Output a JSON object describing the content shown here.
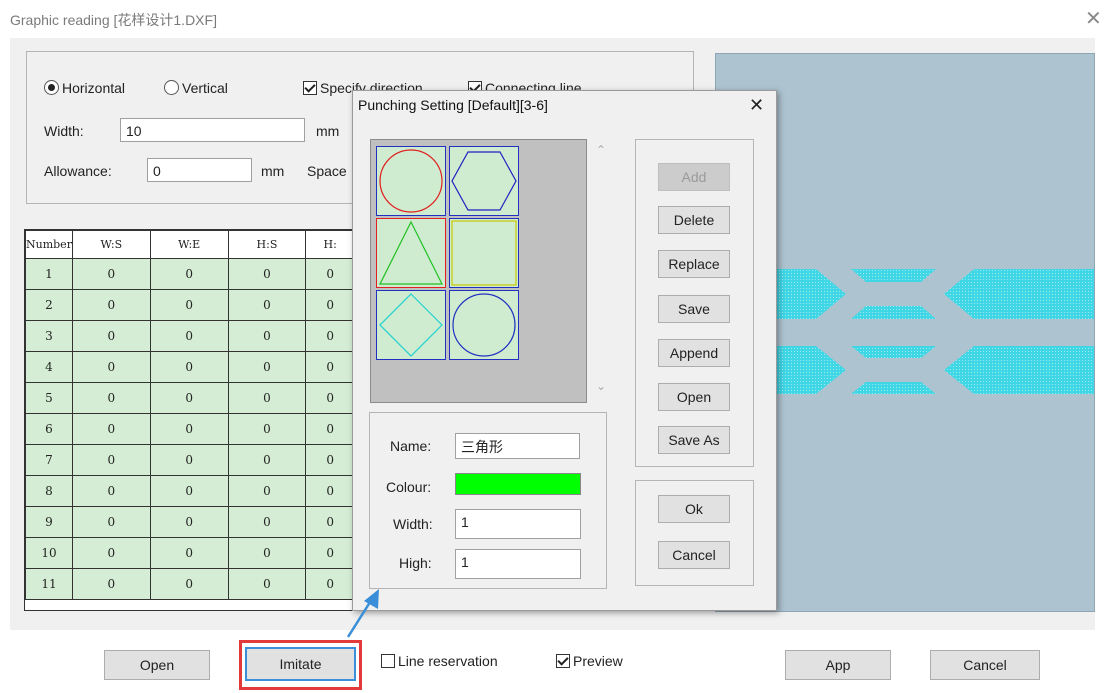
{
  "window": {
    "title": "Graphic reading [花样设计1.DXF]",
    "close_symbol": "✕"
  },
  "settings": {
    "horizontal_label": "Horizontal",
    "vertical_label": "Vertical",
    "orientation_selected": "Horizontal",
    "specify_direction_label": "Specify direction",
    "specify_direction_checked": true,
    "connecting_line_label": "Connecting line",
    "connecting_line_checked": true,
    "width_label": "Width:",
    "width_value": "10",
    "width_unit": "mm",
    "allowance_label": "Allowance:",
    "allowance_value": "0",
    "allowance_unit": "mm",
    "space_label": "Space"
  },
  "table": {
    "headers": [
      "Number",
      "W:S",
      "W:E",
      "H:S",
      "H:"
    ],
    "rows": [
      [
        "1",
        "0",
        "0",
        "0",
        "0"
      ],
      [
        "2",
        "0",
        "0",
        "0",
        "0"
      ],
      [
        "3",
        "0",
        "0",
        "0",
        "0"
      ],
      [
        "4",
        "0",
        "0",
        "0",
        "0"
      ],
      [
        "5",
        "0",
        "0",
        "0",
        "0"
      ],
      [
        "6",
        "0",
        "0",
        "0",
        "0"
      ],
      [
        "7",
        "0",
        "0",
        "0",
        "0"
      ],
      [
        "8",
        "0",
        "0",
        "0",
        "0"
      ],
      [
        "9",
        "0",
        "0",
        "0",
        "0"
      ],
      [
        "10",
        "0",
        "0",
        "0",
        "0"
      ],
      [
        "11",
        "0",
        "0",
        "0",
        "0"
      ]
    ]
  },
  "dialog": {
    "title": "Punching Setting [Default][3-6]",
    "close_symbol": "✕",
    "shapes": [
      {
        "kind": "circle",
        "color": "#e02020"
      },
      {
        "kind": "hexagon",
        "color": "#2020c0"
      },
      {
        "kind": "triangle",
        "color": "#20c020"
      },
      {
        "kind": "square",
        "color": "#c8c800"
      },
      {
        "kind": "diamond",
        "color": "#20d0d0"
      },
      {
        "kind": "circle",
        "color": "#2030c0"
      }
    ],
    "selected_index": 2,
    "name_label": "Name:",
    "name_value": "三角形",
    "colour_label": "Colour:",
    "colour_value": "#00ff00",
    "width_label": "Width:",
    "width_value": "1",
    "high_label": "High:",
    "high_value": "1",
    "buttons": {
      "add": "Add",
      "delete": "Delete",
      "replace": "Replace",
      "save": "Save",
      "append": "Append",
      "open": "Open",
      "save_as": "Save As",
      "ok": "Ok",
      "cancel": "Cancel"
    }
  },
  "bottom": {
    "open": "Open",
    "imitate": "Imitate",
    "line_reservation_label": "Line reservation",
    "line_reservation_checked": false,
    "preview_label": "Preview",
    "preview_checked": true,
    "app": "App",
    "cancel": "Cancel"
  },
  "colors": {
    "preview_background": "#adc3cf",
    "preview_pattern": "#3fd7e6",
    "callout_arrow": "#3a8fd8",
    "highlight_box": "#e23a3a"
  }
}
